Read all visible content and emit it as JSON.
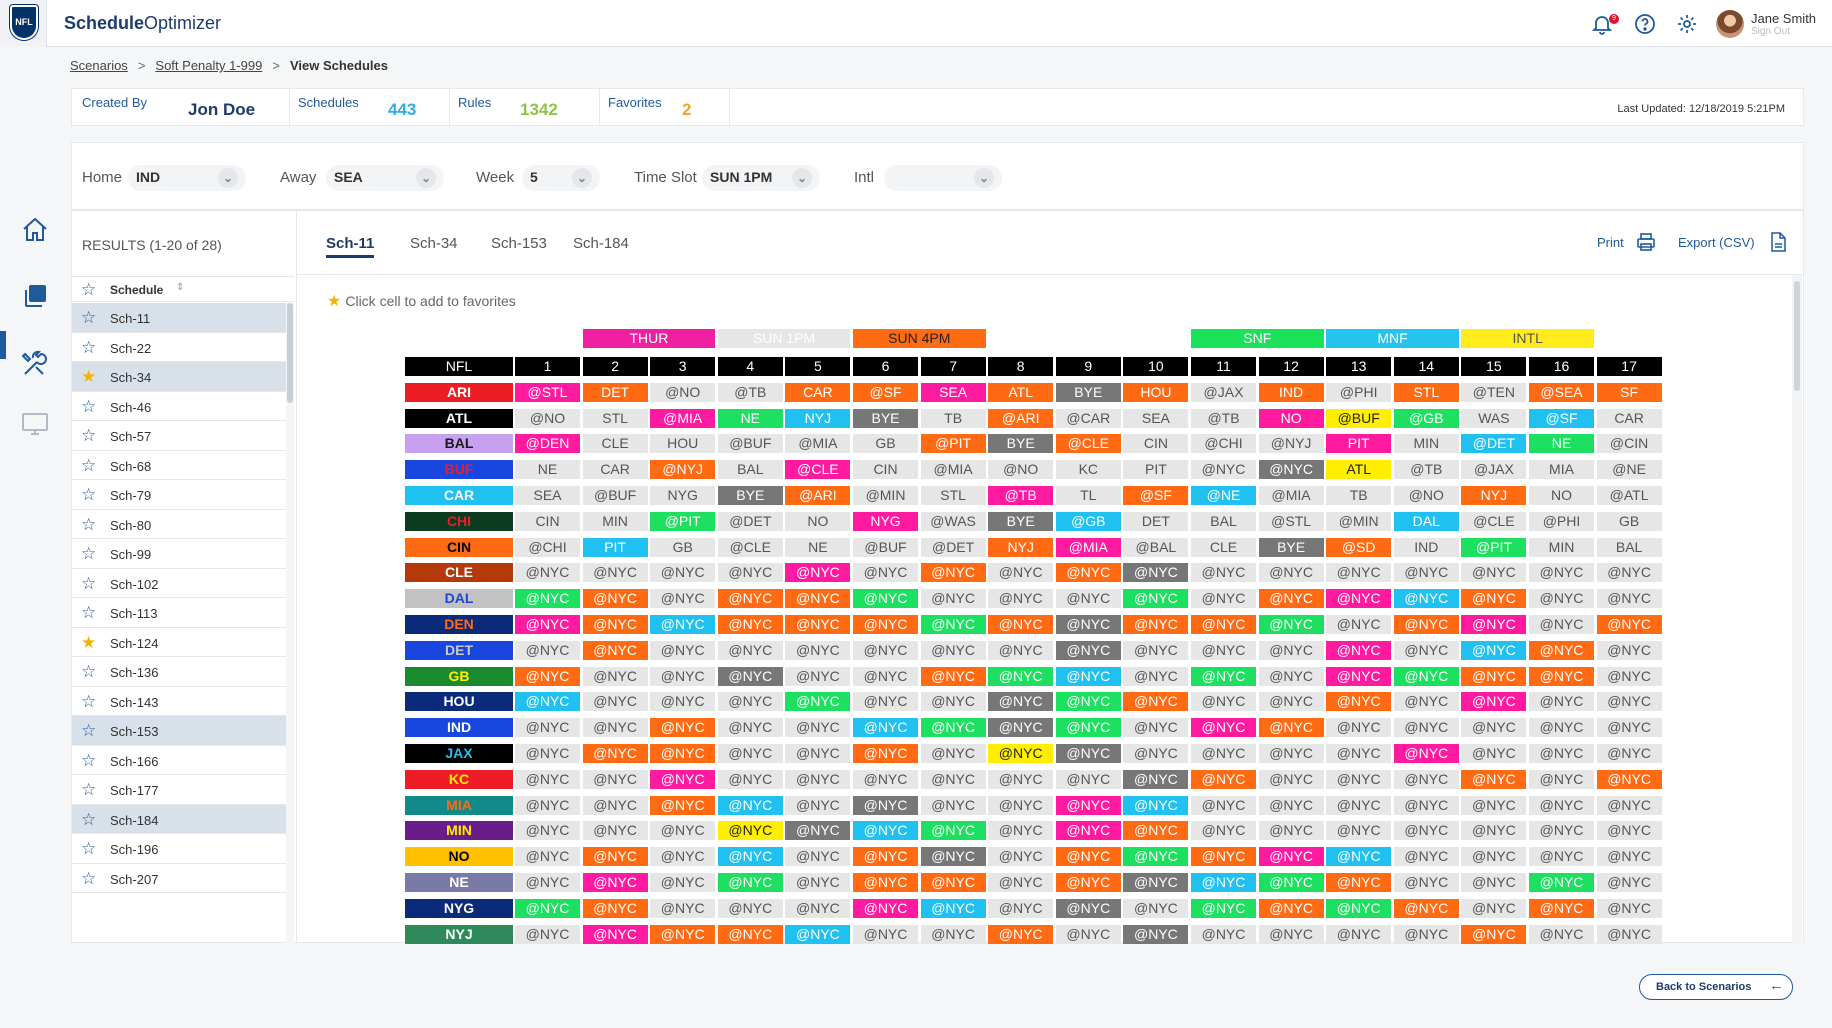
{
  "app": {
    "logo_text": "NFL",
    "title_bold": "Schedule",
    "title_rest": "Optimizer",
    "notifications": "9",
    "user_name": "Jane Smith",
    "sign_out": "Sign Out"
  },
  "breadcrumb": {
    "items": [
      "Scenarios",
      "Soft Penalty 1-999"
    ],
    "current": "View Schedules",
    "separator": ">"
  },
  "stats": [
    {
      "label": "Created By",
      "value": "Jon Doe",
      "color": "#1d3c6b"
    },
    {
      "label": "Schedules",
      "value": "443",
      "color": "#29aee8"
    },
    {
      "label": "Rules",
      "value": "1342",
      "color": "#8cc63f"
    },
    {
      "label": "Favorites",
      "value": "2",
      "color": "#f5a623"
    }
  ],
  "last_updated": "Last Updated: 12/18/2019 5:21PM",
  "filters": [
    {
      "label": "Home",
      "value": "IND"
    },
    {
      "label": "Away",
      "value": "SEA"
    },
    {
      "label": "Week",
      "value": "5"
    },
    {
      "label": "Time Slot",
      "value": "SUN 1PM"
    },
    {
      "label": "Intl",
      "value": ""
    }
  ],
  "results": {
    "title": "RESULTS (1-20 of 28)",
    "column_header": "Schedule",
    "items": [
      {
        "name": "Sch-11",
        "fav": false,
        "sel": true
      },
      {
        "name": "Sch-22",
        "fav": false,
        "sel": false
      },
      {
        "name": "Sch-34",
        "fav": true,
        "sel": true
      },
      {
        "name": "Sch-46",
        "fav": false,
        "sel": false
      },
      {
        "name": "Sch-57",
        "fav": false,
        "sel": false
      },
      {
        "name": "Sch-68",
        "fav": false,
        "sel": false
      },
      {
        "name": "Sch-79",
        "fav": false,
        "sel": false
      },
      {
        "name": "Sch-80",
        "fav": false,
        "sel": false
      },
      {
        "name": "Sch-99",
        "fav": false,
        "sel": false
      },
      {
        "name": "Sch-102",
        "fav": false,
        "sel": false
      },
      {
        "name": "Sch-113",
        "fav": false,
        "sel": false
      },
      {
        "name": "Sch-124",
        "fav": true,
        "sel": false
      },
      {
        "name": "Sch-136",
        "fav": false,
        "sel": false
      },
      {
        "name": "Sch-143",
        "fav": false,
        "sel": false
      },
      {
        "name": "Sch-153",
        "fav": false,
        "sel": true
      },
      {
        "name": "Sch-166",
        "fav": false,
        "sel": false
      },
      {
        "name": "Sch-177",
        "fav": false,
        "sel": false
      },
      {
        "name": "Sch-184",
        "fav": false,
        "sel": true
      },
      {
        "name": "Sch-196",
        "fav": false,
        "sel": false
      },
      {
        "name": "Sch-207",
        "fav": false,
        "sel": false
      }
    ]
  },
  "tabs": [
    "Sch-11",
    "Sch-34",
    "Sch-153",
    "Sch-184"
  ],
  "actions": {
    "print": "Print",
    "export": "Export (CSV)"
  },
  "hint": "Click cell to add to favorites",
  "schedule": {
    "corner": "NFL",
    "weeks": [
      "1",
      "2",
      "3",
      "4",
      "5",
      "6",
      "7",
      "8",
      "9",
      "10",
      "11",
      "12",
      "13",
      "14",
      "15",
      "16",
      "17"
    ],
    "slots": [
      {
        "label": "THUR",
        "start": 2,
        "end": 3,
        "bg": "#ee1fa0",
        "fg": "#ffffff"
      },
      {
        "label": "SUN 1PM",
        "start": 4,
        "end": 5,
        "bg": "#e6e6e6",
        "fg": "#ffffff"
      },
      {
        "label": "SUN 4PM",
        "start": 6,
        "end": 7,
        "bg": "#ff6b12",
        "fg": "#222222"
      },
      {
        "label": "SNF",
        "start": 11,
        "end": 12,
        "bg": "#1be05a",
        "fg": "#ffffff"
      },
      {
        "label": "MNF",
        "start": 13,
        "end": 14,
        "bg": "#25c4ee",
        "fg": "#ffffff"
      },
      {
        "label": "INTL",
        "start": 15,
        "end": 16,
        "bg": "#ffec1a",
        "fg": "#555555"
      }
    ],
    "colors": {
      "g": "#e6e6e6",
      "o": "#ff6a13",
      "p": "#ff1aa0",
      "c": "#20c1f0",
      "n": "#1ee060",
      "d": "#777777",
      "y": "#ffee00"
    },
    "text_colors": {
      "g": "#555555",
      "o": "#ffffff",
      "p": "#ffffff",
      "c": "#ffffff",
      "n": "#ffffff",
      "d": "#ffffff",
      "y": "#222222"
    },
    "teams": [
      {
        "name": "ARI",
        "bg": "#ee1c25",
        "fg": "#ffffff",
        "cells": [
          "@STL",
          "DET",
          "@NO",
          "@TB",
          "CAR",
          "@SF",
          "SEA",
          "ATL",
          "BYE",
          "HOU",
          "@JAX",
          "IND",
          "@PHI",
          "STL",
          "@TEN",
          "@SEA",
          "SF"
        ],
        "c": "p o g g o o p o d o g o g o g o o"
      },
      {
        "name": "ATL",
        "bg": "#000000",
        "fg": "#ffffff",
        "cells": [
          "@NO",
          "STL",
          "@MIA",
          "NE",
          "NYJ",
          "BYE",
          "TB",
          "@ARI",
          "@CAR",
          "SEA",
          "@TB",
          "NO",
          "@BUF",
          "@GB",
          "WAS",
          "@SF",
          "CAR"
        ],
        "c": "g g p n c d g o g g g p y n g c g"
      },
      {
        "name": "BAL",
        "bg": "#c8a0f0",
        "fg": "#1a1a1a",
        "cells": [
          "@DEN",
          "CLE",
          "HOU",
          "@BUF",
          "@MIA",
          "GB",
          "@PIT",
          "BYE",
          "@CLE",
          "CIN",
          "@CHI",
          "@NYJ",
          "PIT",
          "MIN",
          "@DET",
          "NE",
          "@CIN"
        ],
        "c": "p g g g g g o d o g g g p g c n g"
      },
      {
        "name": "BUF",
        "bg": "#1a46e0",
        "fg": "#ee1c25",
        "cells": [
          "NE",
          "CAR",
          "@NYJ",
          "BAL",
          "@CLE",
          "CIN",
          "@MIA",
          "@NO",
          "KC",
          "PIT",
          "@NYC",
          "@NYC",
          "ATL",
          "@TB",
          "@JAX",
          "MIA",
          "@NE"
        ],
        "c": "g g o g p g g g g g g d y g g g g"
      },
      {
        "name": "CAR",
        "bg": "#20c1f0",
        "fg": "#ffffff",
        "cells": [
          "SEA",
          "@BUF",
          "NYG",
          "BYE",
          "@ARI",
          "@MIN",
          "STL",
          "@TB",
          "TL",
          "@SF",
          "@NE",
          "@MIA",
          "TB",
          "@NO",
          "NYJ",
          "NO",
          "@ATL"
        ],
        "c": "g g g d o g g p g o c g g g o g g"
      },
      {
        "name": "CHI",
        "bg": "#0b3b20",
        "fg": "#ee1c25",
        "cells": [
          "CIN",
          "MIN",
          "@PIT",
          "@DET",
          "NO",
          "NYG",
          "@WAS",
          "BYE",
          "@GB",
          "DET",
          "BAL",
          "@STL",
          "@MIN",
          "DAL",
          "@CLE",
          "@PHI",
          "GB"
        ],
        "c": "g g n g g p g d c g g g g c g g g"
      },
      {
        "name": "CIN",
        "bg": "#ff6a13",
        "fg": "#000000",
        "cells": [
          "@CHI",
          "PIT",
          "GB",
          "@CLE",
          "NE",
          "@BUF",
          "@DET",
          "NYJ",
          "@MIA",
          "@BAL",
          "CLE",
          "BYE",
          "@SD",
          "IND",
          "@PIT",
          "MIN",
          "BAL"
        ],
        "c": "g c g g g g g o p g g d o g n g g"
      },
      {
        "name": "CLE",
        "bg": "#b5390b",
        "fg": "#ffffff",
        "cells": [
          "@NYC",
          "@NYC",
          "@NYC",
          "@NYC",
          "@NYC",
          "@NYC",
          "@NYC",
          "@NYC",
          "@NYC",
          "@NYC",
          "@NYC",
          "@NYC",
          "@NYC",
          "@NYC",
          "@NYC",
          "@NYC",
          "@NYC"
        ],
        "c": "g g g g p g o g o d g g g g g g g"
      },
      {
        "name": "DAL",
        "bg": "#c2c2c2",
        "fg": "#1a46e0",
        "cells": [
          "@NYC",
          "@NYC",
          "@NYC",
          "@NYC",
          "@NYC",
          "@NYC",
          "@NYC",
          "@NYC",
          "@NYC",
          "@NYC",
          "@NYC",
          "@NYC",
          "@NYC",
          "@NYC",
          "@NYC",
          "@NYC",
          "@NYC"
        ],
        "c": "n o g o o n g g g n g o p c o g g"
      },
      {
        "name": "DEN",
        "bg": "#0b2a7a",
        "fg": "#ff6a13",
        "cells": [
          "@NYC",
          "@NYC",
          "@NYC",
          "@NYC",
          "@NYC",
          "@NYC",
          "@NYC",
          "@NYC",
          "@NYC",
          "@NYC",
          "@NYC",
          "@NYC",
          "@NYC",
          "@NYC",
          "@NYC",
          "@NYC",
          "@NYC"
        ],
        "c": "p o c o o o n o d o o n g o p g o"
      },
      {
        "name": "DET",
        "bg": "#1a46e0",
        "fg": "#c8c8c8",
        "cells": [
          "@NYC",
          "@NYC",
          "@NYC",
          "@NYC",
          "@NYC",
          "@NYC",
          "@NYC",
          "@NYC",
          "@NYC",
          "@NYC",
          "@NYC",
          "@NYC",
          "@NYC",
          "@NYC",
          "@NYC",
          "@NYC",
          "@NYC"
        ],
        "c": "g o g g g g g g d g g g p g c o g"
      },
      {
        "name": "GB",
        "bg": "#1a8a2e",
        "fg": "#ffee00",
        "cells": [
          "@NYC",
          "@NYC",
          "@NYC",
          "@NYC",
          "@NYC",
          "@NYC",
          "@NYC",
          "@NYC",
          "@NYC",
          "@NYC",
          "@NYC",
          "@NYC",
          "@NYC",
          "@NYC",
          "@NYC",
          "@NYC",
          "@NYC"
        ],
        "c": "o g g d g g o n c g n g p n o o g"
      },
      {
        "name": "HOU",
        "bg": "#0b2a7a",
        "fg": "#ffffff",
        "cells": [
          "@NYC",
          "@NYC",
          "@NYC",
          "@NYC",
          "@NYC",
          "@NYC",
          "@NYC",
          "@NYC",
          "@NYC",
          "@NYC",
          "@NYC",
          "@NYC",
          "@NYC",
          "@NYC",
          "@NYC",
          "@NYC",
          "@NYC"
        ],
        "c": "c g g g n g g d n o g g o g p g g"
      },
      {
        "name": "IND",
        "bg": "#1a46e0",
        "fg": "#ffffff",
        "cells": [
          "@NYC",
          "@NYC",
          "@NYC",
          "@NYC",
          "@NYC",
          "@NYC",
          "@NYC",
          "@NYC",
          "@NYC",
          "@NYC",
          "@NYC",
          "@NYC",
          "@NYC",
          "@NYC",
          "@NYC",
          "@NYC",
          "@NYC"
        ],
        "c": "g g o g g c n d n g p o g g g g g"
      },
      {
        "name": "JAX",
        "bg": "#000000",
        "fg": "#20c1f0",
        "cells": [
          "@NYC",
          "@NYC",
          "@NYC",
          "@NYC",
          "@NYC",
          "@NYC",
          "@NYC",
          "@NYC",
          "@NYC",
          "@NYC",
          "@NYC",
          "@NYC",
          "@NYC",
          "@NYC",
          "@NYC",
          "@NYC",
          "@NYC"
        ],
        "c": "g o o g g o g y d g g g g p g g g"
      },
      {
        "name": "KC",
        "bg": "#ee1c25",
        "fg": "#ffee00",
        "cells": [
          "@NYC",
          "@NYC",
          "@NYC",
          "@NYC",
          "@NYC",
          "@NYC",
          "@NYC",
          "@NYC",
          "@NYC",
          "@NYC",
          "@NYC",
          "@NYC",
          "@NYC",
          "@NYC",
          "@NYC",
          "@NYC",
          "@NYC"
        ],
        "c": "g g p g g g g g g d o g g g o g o"
      },
      {
        "name": "MIA",
        "bg": "#138a8a",
        "fg": "#ff6a13",
        "cells": [
          "@NYC",
          "@NYC",
          "@NYC",
          "@NYC",
          "@NYC",
          "@NYC",
          "@NYC",
          "@NYC",
          "@NYC",
          "@NYC",
          "@NYC",
          "@NYC",
          "@NYC",
          "@NYC",
          "@NYC",
          "@NYC",
          "@NYC"
        ],
        "c": "g g o c g d g g p c g g g g g g g"
      },
      {
        "name": "MIN",
        "bg": "#6a1d8a",
        "fg": "#ffee00",
        "cells": [
          "@NYC",
          "@NYC",
          "@NYC",
          "@NYC",
          "@NYC",
          "@NYC",
          "@NYC",
          "@NYC",
          "@NYC",
          "@NYC",
          "@NYC",
          "@NYC",
          "@NYC",
          "@NYC",
          "@NYC",
          "@NYC",
          "@NYC"
        ],
        "c": "g g g y d c n g p o g g g g g g g"
      },
      {
        "name": "NO",
        "bg": "#ffc000",
        "fg": "#000000",
        "cells": [
          "@NYC",
          "@NYC",
          "@NYC",
          "@NYC",
          "@NYC",
          "@NYC",
          "@NYC",
          "@NYC",
          "@NYC",
          "@NYC",
          "@NYC",
          "@NYC",
          "@NYC",
          "@NYC",
          "@NYC",
          "@NYC",
          "@NYC"
        ],
        "c": "g o g c g o d g o n o p c g g g g"
      },
      {
        "name": "NE",
        "bg": "#7a7aa8",
        "fg": "#ffffff",
        "cells": [
          "@NYC",
          "@NYC",
          "@NYC",
          "@NYC",
          "@NYC",
          "@NYC",
          "@NYC",
          "@NYC",
          "@NYC",
          "@NYC",
          "@NYC",
          "@NYC",
          "@NYC",
          "@NYC",
          "@NYC",
          "@NYC",
          "@NYC"
        ],
        "c": "g p g n g o o g o d c n o g g n g"
      },
      {
        "name": "NYG",
        "bg": "#0b2a7a",
        "fg": "#ffffff",
        "cells": [
          "@NYC",
          "@NYC",
          "@NYC",
          "@NYC",
          "@NYC",
          "@NYC",
          "@NYC",
          "@NYC",
          "@NYC",
          "@NYC",
          "@NYC",
          "@NYC",
          "@NYC",
          "@NYC",
          "@NYC",
          "@NYC",
          "@NYC"
        ],
        "c": "n o g g g p c g d g n o n o g o g"
      },
      {
        "name": "NYJ",
        "bg": "#2e8a5a",
        "fg": "#ffffff",
        "cells": [
          "@NYC",
          "@NYC",
          "@NYC",
          "@NYC",
          "@NYC",
          "@NYC",
          "@NYC",
          "@NYC",
          "@NYC",
          "@NYC",
          "@NYC",
          "@NYC",
          "@NYC",
          "@NYC",
          "@NYC",
          "@NYC",
          "@NYC"
        ],
        "c": "g p o o c g g o g d g g g g o g g"
      }
    ]
  }
}
